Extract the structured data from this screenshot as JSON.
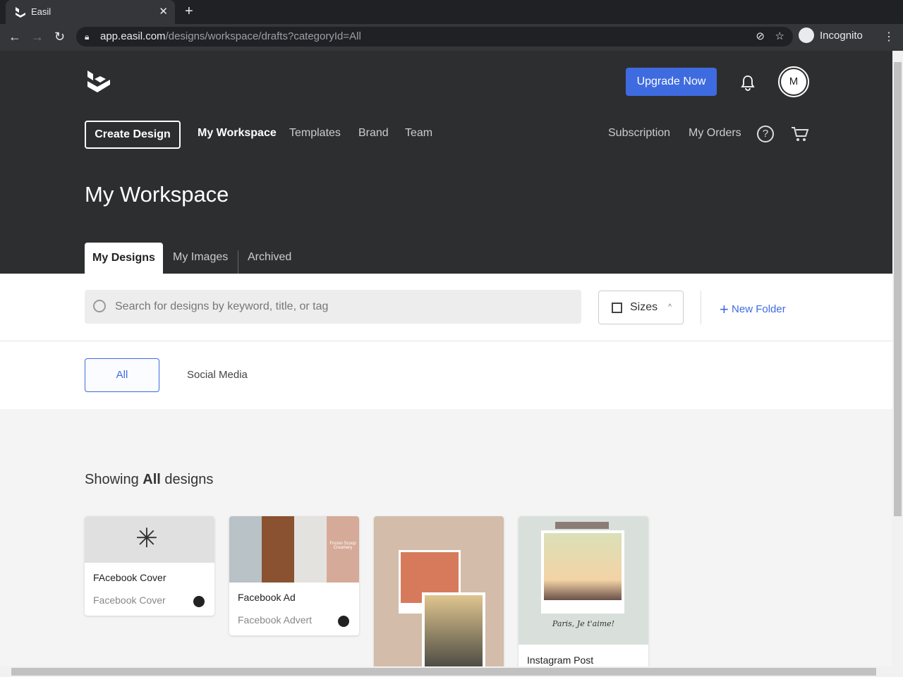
{
  "browser": {
    "tab_title": "Easil",
    "url_host": "app.easil.com",
    "url_path": "/designs/workspace/drafts?categoryId=All",
    "profile": "Incognito"
  },
  "header": {
    "upgrade": "Upgrade Now",
    "avatar": "M",
    "create": "Create Design",
    "nav": [
      "My Workspace",
      "Templates",
      "Brand",
      "Team"
    ],
    "right_nav": [
      "Subscription",
      "My Orders"
    ],
    "title": "My Workspace",
    "tabs": [
      "My Designs",
      "My Images",
      "Archived"
    ]
  },
  "toolbar": {
    "search_placeholder": "Search for designs by keyword, title, or tag",
    "sizes": "Sizes",
    "new_folder": "New Folder"
  },
  "categories": [
    "All",
    "Social Media"
  ],
  "showing": {
    "prefix": "Showing ",
    "bold": "All",
    "suffix": " designs"
  },
  "designs": [
    {
      "name": "FAcebook Cover",
      "type": "Facebook Cover"
    },
    {
      "name": "Facebook Ad",
      "type": "Facebook Advert",
      "thumb_text": "Frozen Scoop Creamery"
    },
    {
      "name": "",
      "type": ""
    },
    {
      "name": "Instagram Post",
      "type": "",
      "thumb_text": "Paris, Je t'aime!"
    }
  ],
  "colors": {
    "accent": "#3f6be0",
    "header_bg": "#2d2e30"
  }
}
